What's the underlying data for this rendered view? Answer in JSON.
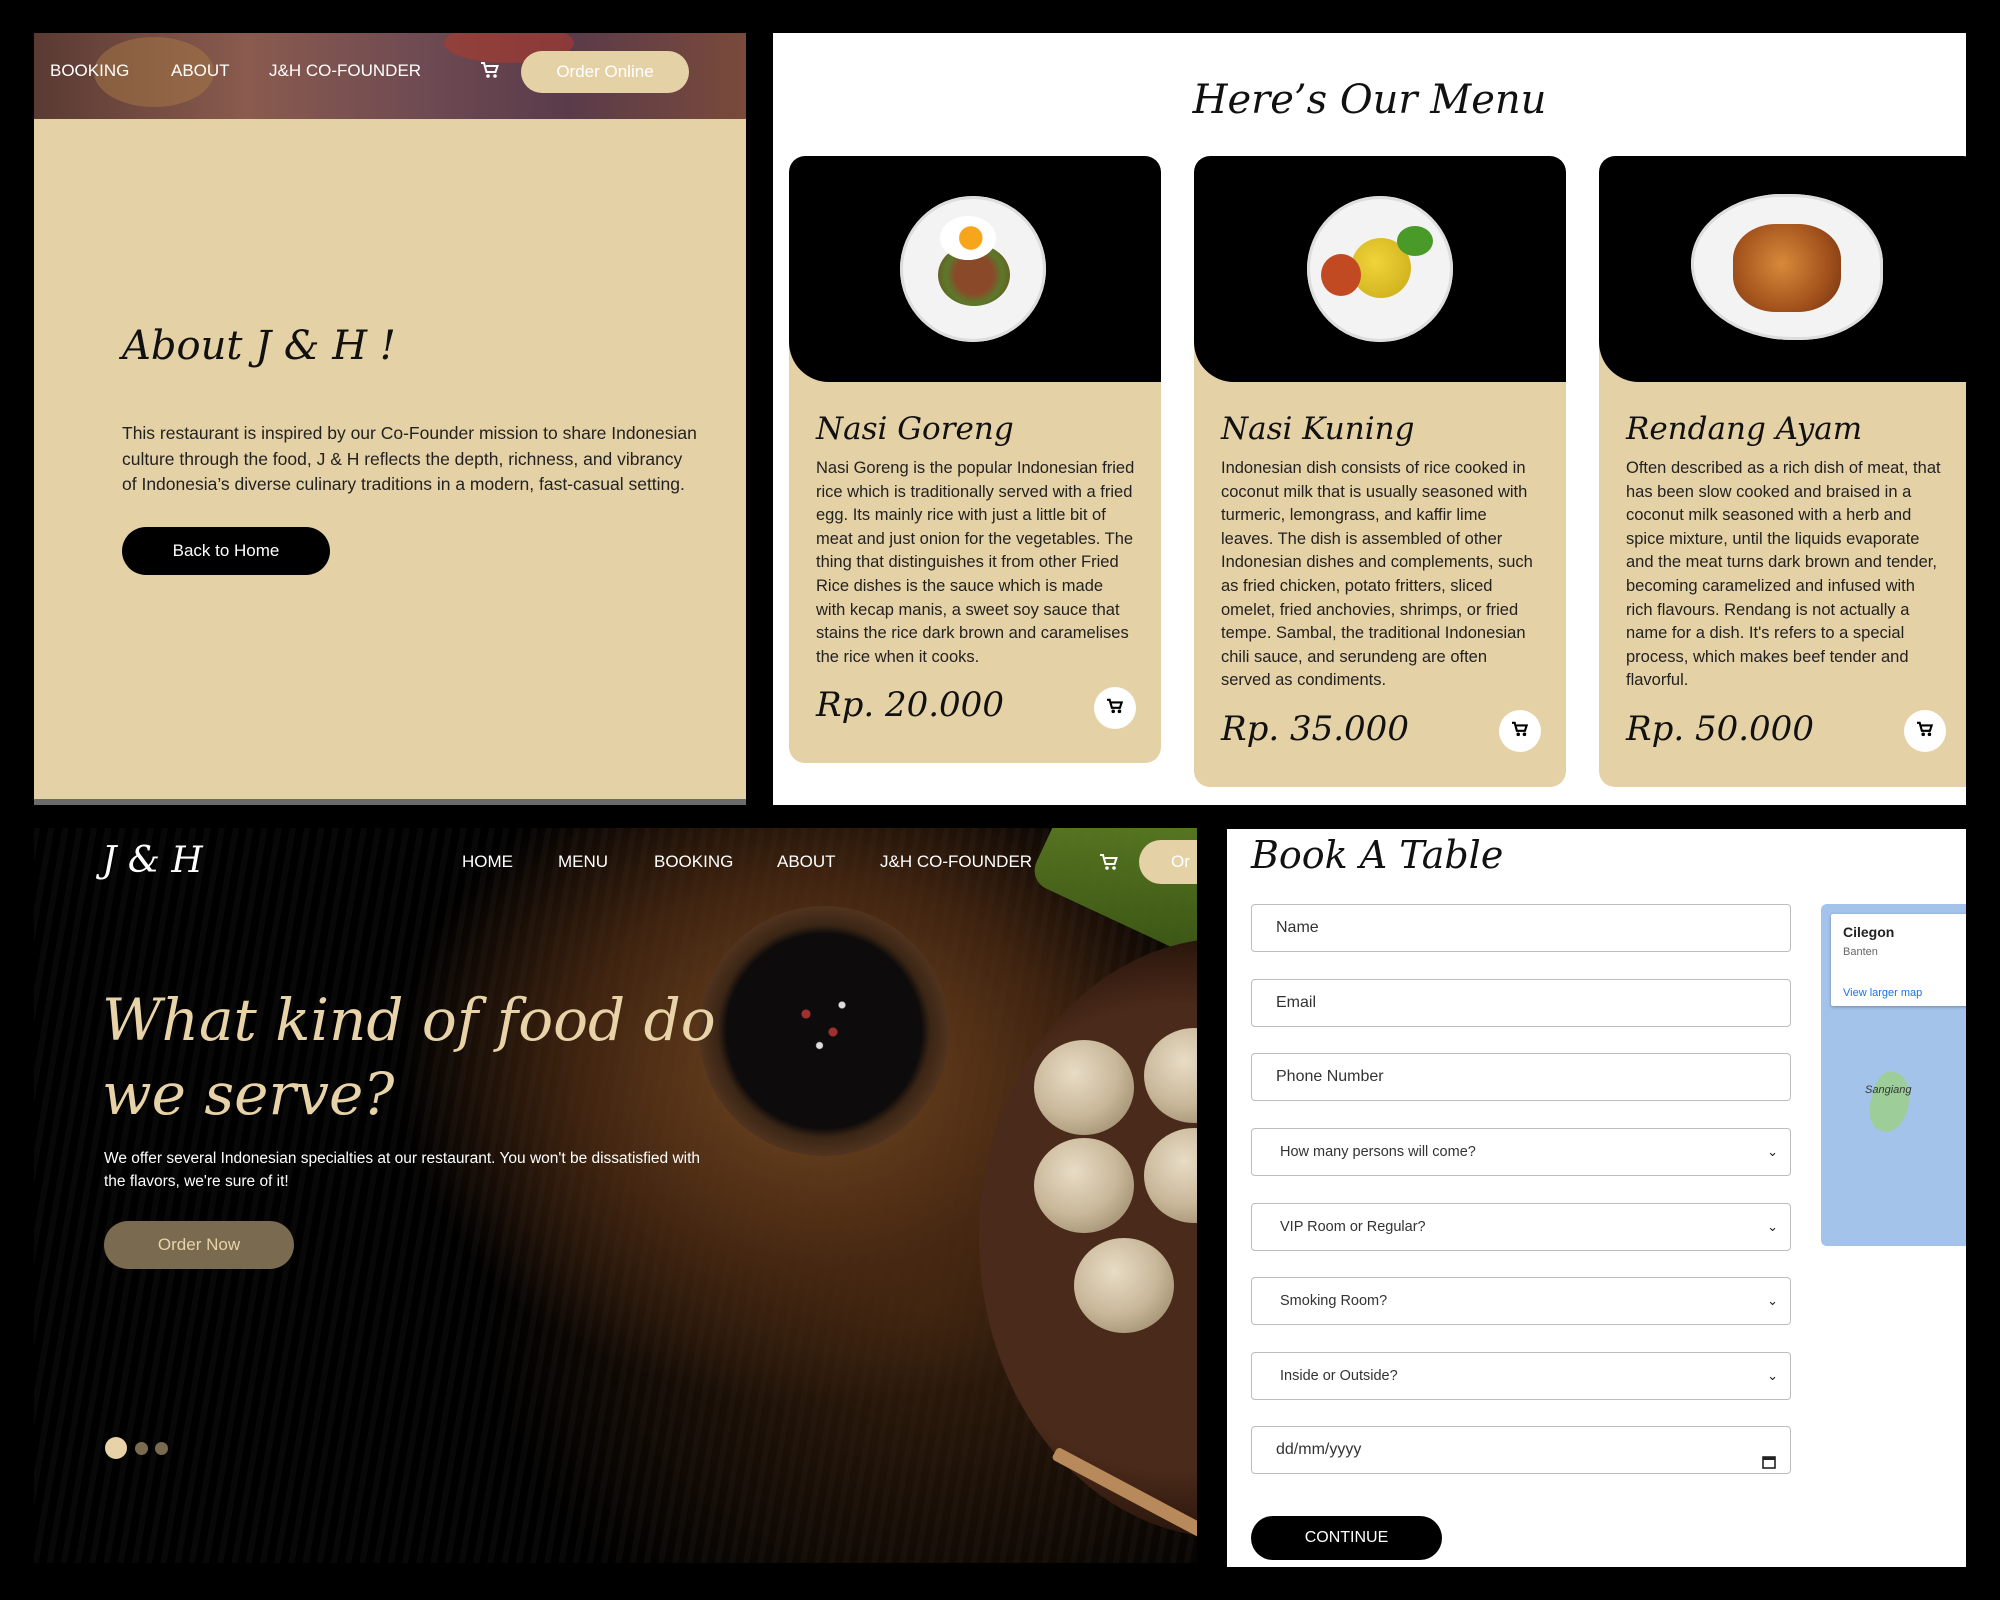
{
  "about_panel": {
    "nav": {
      "booking": "BOOKING",
      "about": "ABOUT",
      "cofounder": "J&H CO-FOUNDER",
      "order_online": "Order Online"
    },
    "title": "About J & H !",
    "text": "This restaurant is inspired by our Co-Founder mission to share Indonesian culture through the food, J & H reflects the depth, richness, and vibrancy of Indonesia’s diverse culinary traditions in a modern, fast-casual setting.",
    "back_button": "Back to Home"
  },
  "menu_panel": {
    "title": "Here’s Our Menu",
    "dishes": [
      {
        "name": "Nasi Goreng",
        "description": "Nasi Goreng is the popular Indonesian fried rice which is traditionally served with a fried egg. Its mainly rice with just a little bit of meat and just onion for the vegetables. The thing that distinguishes it from other Fried Rice dishes is the sauce which is made with kecap manis, a sweet soy sauce that stains the rice dark brown and caramelises the rice when it cooks.",
        "price": "Rp. 20.000"
      },
      {
        "name": "Nasi Kuning",
        "description": "Indonesian dish consists of rice cooked in coconut milk that is usually seasoned with turmeric, lemongrass, and kaffir lime leaves. The dish is assembled of other Indonesian dishes and complements, such as fried chicken, potato fritters, sliced omelet, fried anchovies, shrimps, or fried tempe. Sambal, the traditional Indonesian chili sauce, and serundeng are often served as condiments.",
        "price": "Rp. 35.000"
      },
      {
        "name": "Rendang Ayam",
        "description": "Often described as a rich dish of meat, that has been slow cooked and braised in a coconut milk seasoned with a herb and spice mixture, until the liquids evaporate and the meat turns dark brown and tender, becoming caramelized and infused with rich flavours. Rendang is not actually a name for a dish. It's refers to a special process, which makes beef tender and flavorful.",
        "price": "Rp. 50.000"
      }
    ]
  },
  "hero_panel": {
    "brand": "J & H",
    "nav": {
      "home": "HOME",
      "menu": "MENU",
      "booking": "BOOKING",
      "about": "ABOUT",
      "cofounder": "J&H CO-FOUNDER",
      "order_cut": "Or"
    },
    "title": "What kind of food do we serve?",
    "text": "We offer several Indonesian specialties at our restaurant. You won't be dissatisfied with the flavors, we're sure of it!",
    "order_now": "Order Now",
    "slides": {
      "count": 3,
      "active": 1
    }
  },
  "booking_panel": {
    "title": "Book A Table",
    "fields": {
      "name": "Name",
      "email": "Email",
      "phone": "Phone Number",
      "persons": "How many persons will come?",
      "room": "VIP Room or Regular?",
      "smoking": "Smoking Room?",
      "seating": "Inside or Outside?",
      "date": "dd/mm/yyyy"
    },
    "continue": "CONTINUE",
    "map": {
      "city": "Cilegon",
      "region": "Banten",
      "link": "View larger map",
      "label": "Sangiang"
    }
  },
  "colors": {
    "cream": "#e5d1a6",
    "black": "#000000",
    "hero_title": "#e8d3a8",
    "order_now_bg": "#7a6a4f"
  }
}
